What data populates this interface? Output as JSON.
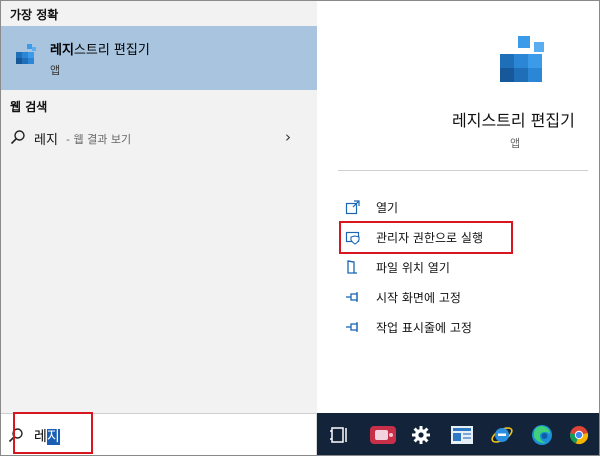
{
  "best_match": {
    "section_title": "가장 정확",
    "app_name_bold": "레지",
    "app_name_rest": "스트리 편집기",
    "app_type": "앱",
    "icon": "registry-editor-icon"
  },
  "web_search": {
    "section_title": "웹 검색",
    "query": "레지",
    "suffix": " - 웹 결과 보기",
    "chevron": "›"
  },
  "detail": {
    "title": "레지스트리 편집기",
    "subtitle": "앱",
    "actions": [
      {
        "label": "열기",
        "icon": "open-icon"
      },
      {
        "label": "관리자 권한으로 실행",
        "icon": "shield-run-as-admin-icon"
      },
      {
        "label": "파일 위치 열기",
        "icon": "file-location-icon"
      },
      {
        "label": "시작 화면에 고정",
        "icon": "pin-icon"
      },
      {
        "label": "작업 표시줄에 고정",
        "icon": "pin-icon"
      }
    ]
  },
  "search_box": {
    "typed_prefix": "레",
    "typed_selected": "지"
  },
  "taskbar": {
    "items": [
      "task-view-icon",
      "camera-app-icon",
      "settings-gear-icon",
      "news-app-icon",
      "internet-explorer-icon",
      "edge-icon",
      "chrome-icon"
    ]
  },
  "colors": {
    "selected_row": "#a8c4df",
    "highlight_box": "#d9151f",
    "taskbar": "#12233a"
  }
}
